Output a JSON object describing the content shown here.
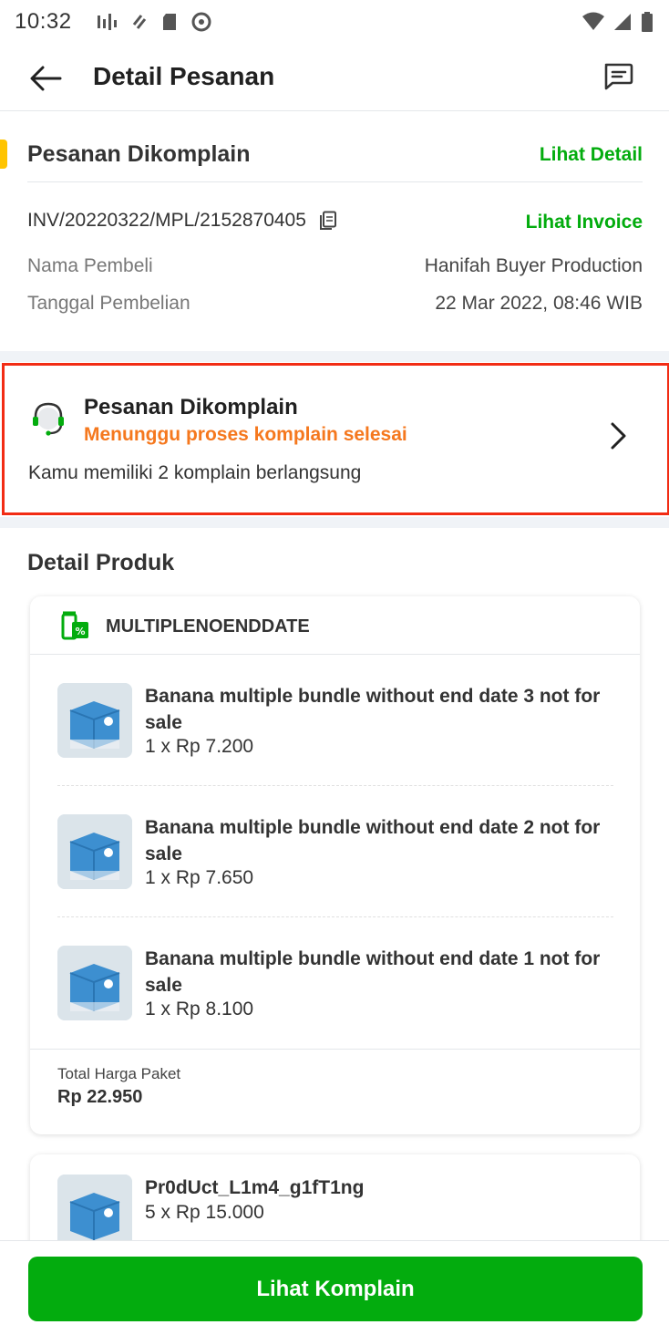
{
  "status_bar": {
    "time": "10:32"
  },
  "app_bar": {
    "title": "Detail Pesanan"
  },
  "order_status": {
    "title": "Pesanan Dikomplain",
    "detail_link": "Lihat Detail",
    "invoice_number": "INV/20220322/MPL/2152870405",
    "invoice_link": "Lihat Invoice",
    "buyer_label": "Nama Pembeli",
    "buyer_value": "Hanifah Buyer Production",
    "date_label": "Tanggal Pembelian",
    "date_value": "22 Mar 2022, 08:46 WIB"
  },
  "complaint": {
    "title": "Pesanan Dikomplain",
    "subtitle": "Menunggu proses komplain selesai",
    "description": "Kamu memiliki 2 komplain berlangsung"
  },
  "product_section": {
    "title": "Detail Produk",
    "bundle": {
      "name": "MULTIPLENOENDDATE",
      "items": [
        {
          "name": "Banana multiple bundle without end date 3 not for sale",
          "price": "1 x Rp 7.200"
        },
        {
          "name": "Banana multiple bundle without end date 2 not for sale",
          "price": "1 x Rp 7.650"
        },
        {
          "name": "Banana multiple bundle without end date 1 not for sale",
          "price": "1 x Rp 8.100"
        }
      ],
      "total_label": "Total Harga Paket",
      "total_value": "Rp 22.950"
    },
    "single_item": {
      "name": "Pr0dUct_L1m4_g1fT1ng",
      "price": "5 x Rp 15.000"
    }
  },
  "cta": {
    "label": "Lihat Komplain"
  },
  "colors": {
    "primary_green": "#03AC0E",
    "accent_orange": "#F5781E",
    "highlight_red": "#F22C14",
    "accent_yellow": "#FFC400"
  }
}
